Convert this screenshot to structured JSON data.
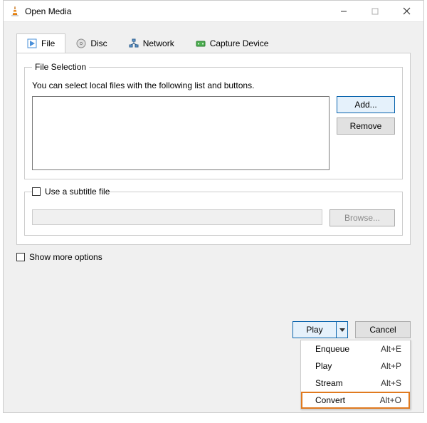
{
  "window": {
    "title": "Open Media"
  },
  "tabs": [
    {
      "id": "file",
      "label": "File",
      "active": true
    },
    {
      "id": "disc",
      "label": "Disc",
      "active": false
    },
    {
      "id": "network",
      "label": "Network",
      "active": false
    },
    {
      "id": "capture",
      "label": "Capture Device",
      "active": false
    }
  ],
  "file_selection": {
    "legend": "File Selection",
    "hint": "You can select local files with the following list and buttons.",
    "add_label": "Add...",
    "remove_label": "Remove"
  },
  "subtitle": {
    "checkbox_label": "Use a subtitle file",
    "browse_label": "Browse..."
  },
  "options": {
    "show_more_label": "Show more options"
  },
  "actions": {
    "play_label": "Play",
    "cancel_label": "Cancel"
  },
  "menu": [
    {
      "label": "Enqueue",
      "shortcut": "Alt+E"
    },
    {
      "label": "Play",
      "shortcut": "Alt+P"
    },
    {
      "label": "Stream",
      "shortcut": "Alt+S"
    },
    {
      "label": "Convert",
      "shortcut": "Alt+O",
      "highlighted": true
    }
  ]
}
